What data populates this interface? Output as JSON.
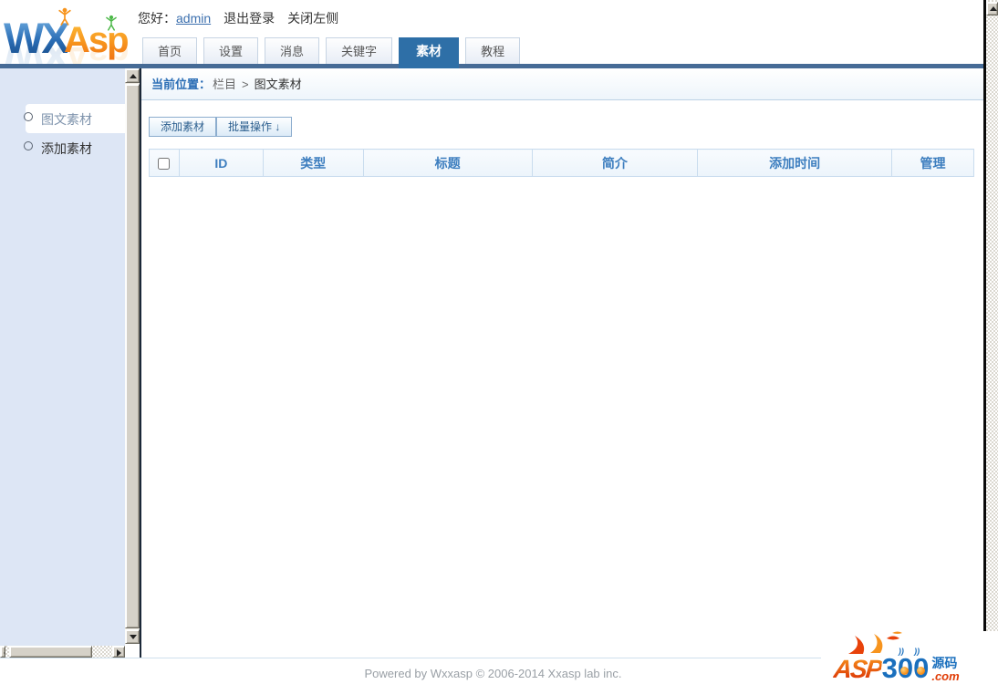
{
  "header": {
    "logo": {
      "wx": "WX",
      "asp": "Asp"
    },
    "greeting_prefix": "您好：",
    "username": "admin",
    "logout": "退出登录",
    "close_left": "关闭左侧",
    "tabs": [
      {
        "label": "首页",
        "active": false
      },
      {
        "label": "设置",
        "active": false
      },
      {
        "label": "消息",
        "active": false
      },
      {
        "label": "关键字",
        "active": false
      },
      {
        "label": "素材",
        "active": true
      },
      {
        "label": "教程",
        "active": false
      }
    ]
  },
  "breadcrumb": {
    "prefix": "当前位置：",
    "section": "栏目",
    "separator": ">",
    "current": "图文素材"
  },
  "sidebar": {
    "items": [
      {
        "label": "图文素材",
        "selected": true
      },
      {
        "label": "添加素材",
        "selected": false
      }
    ]
  },
  "toolbar": {
    "add_material": "添加素材",
    "batch_operation": "批量操作 ↓"
  },
  "table": {
    "headers": [
      "ID",
      "类型",
      "标题",
      "简介",
      "添加时间",
      "管理"
    ],
    "rows": []
  },
  "footer": {
    "copyright": "Powered by Wxxasp © 2006-2014 Xxasp lab inc."
  },
  "watermark": {
    "asp": "ASP",
    "digit": "3",
    "zero": "0",
    "suffix_cn": "源码",
    "suffix_com": ".com"
  },
  "colors": {
    "accent_blue": "#2e6fa7",
    "bar_blue": "#466b96",
    "sidebar_bg": "#dde6f5",
    "table_header_text": "#3d7ebf"
  }
}
